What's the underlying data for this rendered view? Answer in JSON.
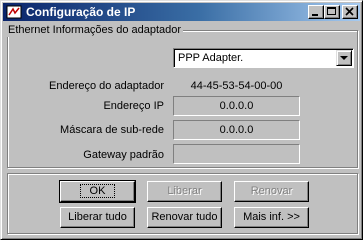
{
  "window": {
    "title": "Configuração de IP"
  },
  "adapter_group": {
    "label": "Ethernet  Informações do adaptador",
    "adapter_select": {
      "selected": "PPP Adapter."
    },
    "fields": [
      {
        "label": "Endereço do adaptador",
        "value": "44-45-53-54-00-00"
      },
      {
        "label": "Endereço IP",
        "value": "0.0.0.0"
      },
      {
        "label": "Máscara de sub-rede",
        "value": "0.0.0.0"
      },
      {
        "label": "Gateway padrão",
        "value": ""
      }
    ]
  },
  "buttons": {
    "ok": "OK",
    "release": "Liberar",
    "renew": "Renovar",
    "release_all": "Liberar tudo",
    "renew_all": "Renovar tudo",
    "more_info": "Mais inf. >>"
  }
}
